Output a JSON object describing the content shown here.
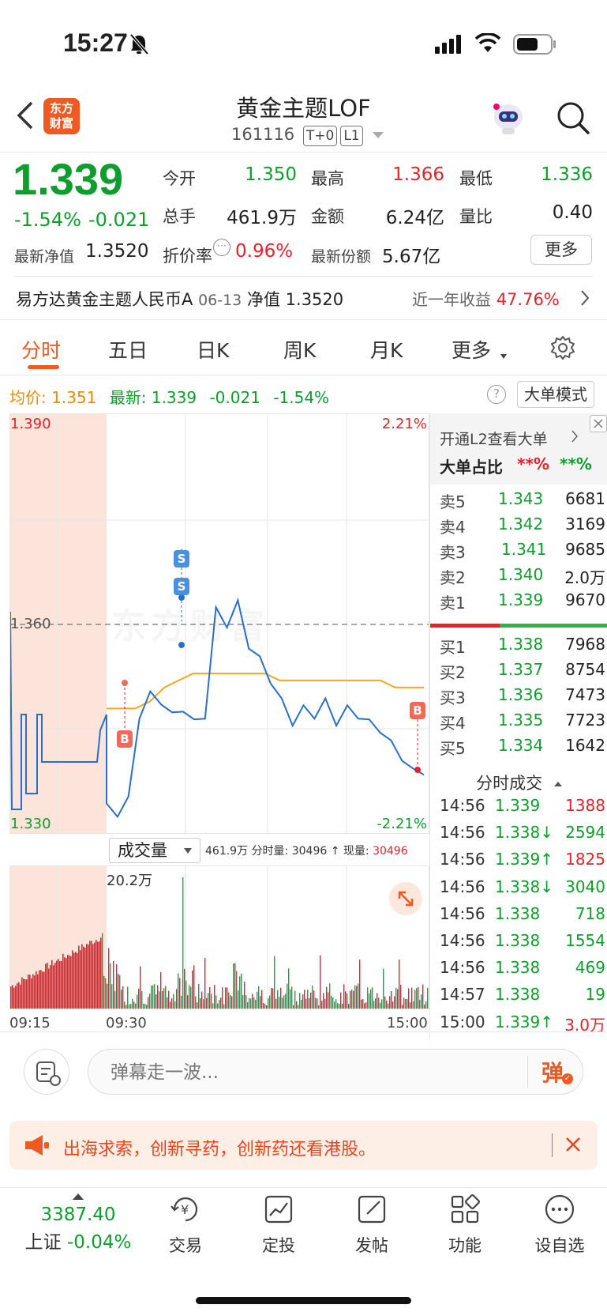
{
  "status": {
    "time": "15:27"
  },
  "header": {
    "back_label": "‹",
    "logo_text": "东方\n财富",
    "title": "黄金主题LOF",
    "code": "161116",
    "tag1": "T+0",
    "tag2": "L1"
  },
  "quote": {
    "price": "1.339",
    "change_pct": "-1.54%",
    "change": "-0.021",
    "open_label": "今开",
    "open": "1.350",
    "high_label": "最高",
    "high": "1.366",
    "low_label": "最低",
    "low": "1.336",
    "vol_label": "总手",
    "vol": "461.9万",
    "amount_label": "金额",
    "amount": "6.24亿",
    "ratio_label": "量比",
    "ratio": "0.40",
    "nav_label": "最新净值",
    "nav": "1.3520",
    "premium_label": "折价率",
    "premium": "0.96%",
    "shares_label": "最新份额",
    "shares": "5.67亿",
    "more_label": "更多"
  },
  "fund_bar": {
    "name": "易方达黄金主题人民币A",
    "date": "06-13",
    "nav_label": "净值",
    "nav": "1.3520",
    "return_label": "近一年收益",
    "return": "47.76%"
  },
  "tabs": [
    "分时",
    "五日",
    "日K",
    "周K",
    "月K",
    "更多"
  ],
  "active_tab": "分时",
  "info_line": {
    "avg_label": "均价:",
    "avg": "1.351",
    "latest_label": "最新:",
    "latest": "1.339",
    "change": "-0.021",
    "pct": "-1.54%",
    "mode_label": "大单模式"
  },
  "chart_axis": {
    "y_top": "1.390",
    "y_mid": "1.360",
    "y_bottom": "1.330",
    "pct_top": "2.21%",
    "pct_bottom": "-2.21%",
    "watermark": "东方财富"
  },
  "volume_bar": {
    "selector": "成交量",
    "total": "461.9万",
    "fenshi_label": "分时量:",
    "fenshi": "30496",
    "now_label": "现量:",
    "now": "30496",
    "max_label": "20.2万",
    "time_start": "09:15",
    "time_open": "09:30",
    "time_end": "15:00"
  },
  "chart_data": {
    "type": "line",
    "series": [
      {
        "name": "price",
        "values": [
          1.334,
          1.333,
          1.335,
          1.347,
          1.35,
          1.349,
          1.347,
          1.348,
          1.346,
          1.347,
          1.362,
          1.36,
          1.363,
          1.357,
          1.355,
          1.352,
          1.349,
          1.346,
          1.348,
          1.347,
          1.349,
          1.346,
          1.348,
          1.347,
          1.346,
          1.345,
          1.343,
          1.341,
          1.339,
          1.339
        ]
      },
      {
        "name": "avg",
        "values": [
          1.348,
          1.348,
          1.348,
          1.349,
          1.351,
          1.352,
          1.353,
          1.353,
          1.353,
          1.353,
          1.353,
          1.353,
          1.352,
          1.352,
          1.352,
          1.352,
          1.352,
          1.352,
          1.352,
          1.352,
          1.351,
          1.351,
          1.351
        ]
      }
    ],
    "ylim": [
      1.33,
      1.39
    ]
  },
  "l2": {
    "title": "开通L2查看大单",
    "ratio_label": "大单占比",
    "ratio1": "**%",
    "ratio2": "**%"
  },
  "orderbook": {
    "asks": [
      {
        "label": "卖5",
        "price": "1.343",
        "vol": "6681"
      },
      {
        "label": "卖4",
        "price": "1.342",
        "vol": "3169"
      },
      {
        "label": "卖3",
        "price": "1.341",
        "vol": "9685"
      },
      {
        "label": "卖2",
        "price": "1.340",
        "vol": "2.0万"
      },
      {
        "label": "卖1",
        "price": "1.339",
        "vol": "9670"
      }
    ],
    "bids": [
      {
        "label": "买1",
        "price": "1.338",
        "vol": "7968"
      },
      {
        "label": "买2",
        "price": "1.337",
        "vol": "8754"
      },
      {
        "label": "买3",
        "price": "1.336",
        "vol": "7473"
      },
      {
        "label": "买4",
        "price": "1.335",
        "vol": "7723"
      },
      {
        "label": "买5",
        "price": "1.334",
        "vol": "1642"
      }
    ]
  },
  "trades_title": "分时成交",
  "trades": [
    {
      "time": "14:56",
      "price": "1.339",
      "vol": "1388",
      "pc": "green",
      "vc": "red"
    },
    {
      "time": "14:56",
      "price": "1.338↓",
      "vol": "2594",
      "pc": "green",
      "vc": "green"
    },
    {
      "time": "14:56",
      "price": "1.339↑",
      "vol": "1825",
      "pc": "green",
      "vc": "red"
    },
    {
      "time": "14:56",
      "price": "1.338↓",
      "vol": "3040",
      "pc": "green",
      "vc": "green"
    },
    {
      "time": "14:56",
      "price": "1.338",
      "vol": "718",
      "pc": "green",
      "vc": "green"
    },
    {
      "time": "14:56",
      "price": "1.338",
      "vol": "1554",
      "pc": "green",
      "vc": "green"
    },
    {
      "time": "14:56",
      "price": "1.338",
      "vol": "469",
      "pc": "green",
      "vc": "green"
    },
    {
      "time": "14:57",
      "price": "1.338",
      "vol": "19",
      "pc": "green",
      "vc": "green"
    },
    {
      "time": "15:00",
      "price": "1.339↑",
      "vol": "3.0万",
      "pc": "green",
      "vc": "red"
    }
  ],
  "danmu": {
    "placeholder": "弹幕走一波...",
    "send": "弹"
  },
  "banner": {
    "text": "出海求索，创新寻药，创新药还看港股。"
  },
  "bottom_nav": {
    "index_value": "3387.40",
    "index_name": "上证",
    "index_change": "-0.04%",
    "items": [
      "交易",
      "定投",
      "发帖",
      "功能",
      "设自选"
    ]
  },
  "colors": {
    "up": "#e8212b",
    "down": "#0f9e2e",
    "line": "#2a6fc9",
    "avg": "#f5a623",
    "accent": "#f05a22"
  }
}
